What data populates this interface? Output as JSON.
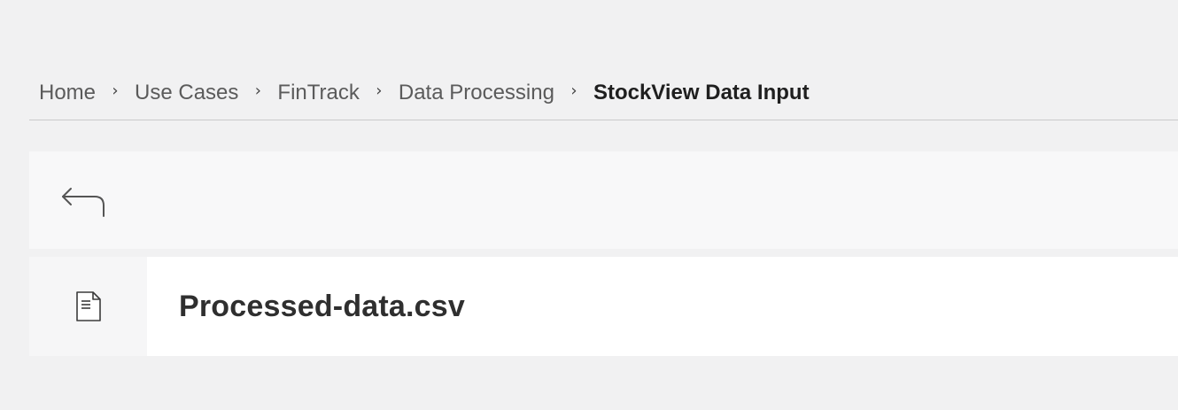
{
  "breadcrumb": {
    "items": [
      {
        "label": "Home"
      },
      {
        "label": "Use Cases"
      },
      {
        "label": "FinTrack"
      },
      {
        "label": "Data Processing"
      },
      {
        "label": "StockView Data Input"
      }
    ],
    "separator": "›"
  },
  "back_bar": {
    "icon": "back-arrow-icon"
  },
  "file": {
    "icon": "document-icon",
    "name": "Processed-data.csv"
  }
}
